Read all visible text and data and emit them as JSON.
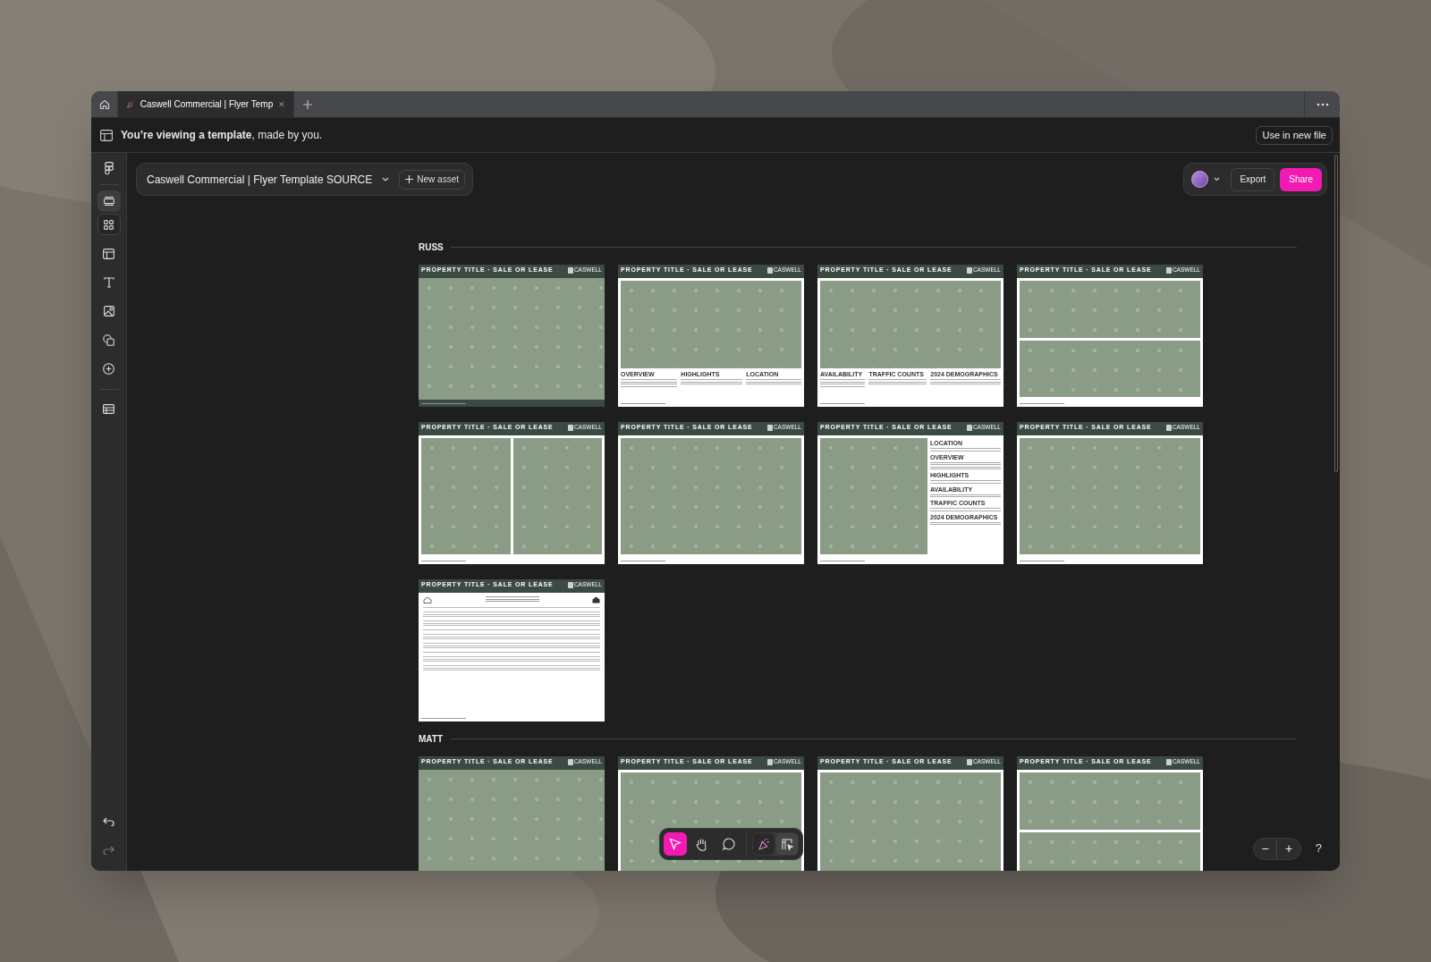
{
  "tabs": [
    {
      "label": "Caswell Commercial | Flyer Temp",
      "selected": true
    }
  ],
  "banner": {
    "text": "**You’re viewing a template**, made by you.",
    "button": "Use in new file"
  },
  "file": {
    "title": "Caswell Commercial | Flyer Template SOURCE",
    "new_asset": "New asset"
  },
  "actions": {
    "export": "Export",
    "share": "Share"
  },
  "view_modes": [
    {
      "selected": true
    },
    {
      "selected": false
    }
  ],
  "tools": [
    {
      "selected": true
    },
    {
      "selected": false
    },
    {
      "selected": false
    }
  ],
  "modes": [
    {
      "selected": true
    },
    {
      "selected": false
    }
  ],
  "zoom_controls": {
    "minus": "−",
    "plus": "+",
    "help": "?"
  },
  "sections": [
    {
      "label": "RUSS",
      "cards": [
        {
          "kind": "full",
          "title": "PROPERTY TITLE · SALE OR LEASE",
          "logo": "CASWELL"
        },
        {
          "kind": "info_bottom",
          "title": "PROPERTY TITLE · SALE OR LEASE",
          "logo": "CASWELL",
          "headings": [
            "OVERVIEW",
            "HIGHLIGHTS",
            "LOCATION"
          ]
        },
        {
          "kind": "info_bottom",
          "title": "PROPERTY TITLE · SALE OR LEASE",
          "logo": "CASWELL",
          "headings": [
            "AVAILABILITY",
            "TRAFFIC COUNTS",
            "2024 DEMOGRAPHICS"
          ]
        },
        {
          "kind": "stacked",
          "title": "PROPERTY TITLE · SALE OR LEASE",
          "logo": "CASWELL"
        },
        {
          "kind": "split",
          "title": "PROPERTY TITLE · SALE OR LEASE",
          "logo": "CASWELL"
        },
        {
          "kind": "bordered",
          "title": "PROPERTY TITLE · SALE OR LEASE",
          "logo": "CASWELL"
        },
        {
          "kind": "sidebar",
          "title": "PROPERTY TITLE · SALE OR LEASE",
          "logo": "CASWELL",
          "headings": [
            "LOCATION",
            "OVERVIEW",
            "HIGHLIGHTS",
            "AVAILABILITY",
            "TRAFFIC COUNTS",
            "2024 DEMOGRAPHICS"
          ]
        },
        {
          "kind": "bordered",
          "title": "PROPERTY TITLE · SALE OR LEASE",
          "logo": "CASWELL"
        },
        {
          "kind": "document",
          "title": "PROPERTY TITLE · SALE OR LEASE",
          "logo": "CASWELL"
        }
      ]
    },
    {
      "label": "MATT",
      "cards": [
        {
          "kind": "full",
          "title": "PROPERTY TITLE · SALE OR LEASE",
          "logo": "CASWELL"
        },
        {
          "kind": "bordered",
          "title": "PROPERTY TITLE · SALE OR LEASE",
          "logo": "CASWELL"
        },
        {
          "kind": "bordered",
          "title": "PROPERTY TITLE · SALE OR LEASE",
          "logo": "CASWELL"
        },
        {
          "kind": "stacked",
          "title": "PROPERTY TITLE · SALE OR LEASE",
          "logo": "CASWELL"
        }
      ]
    }
  ]
}
